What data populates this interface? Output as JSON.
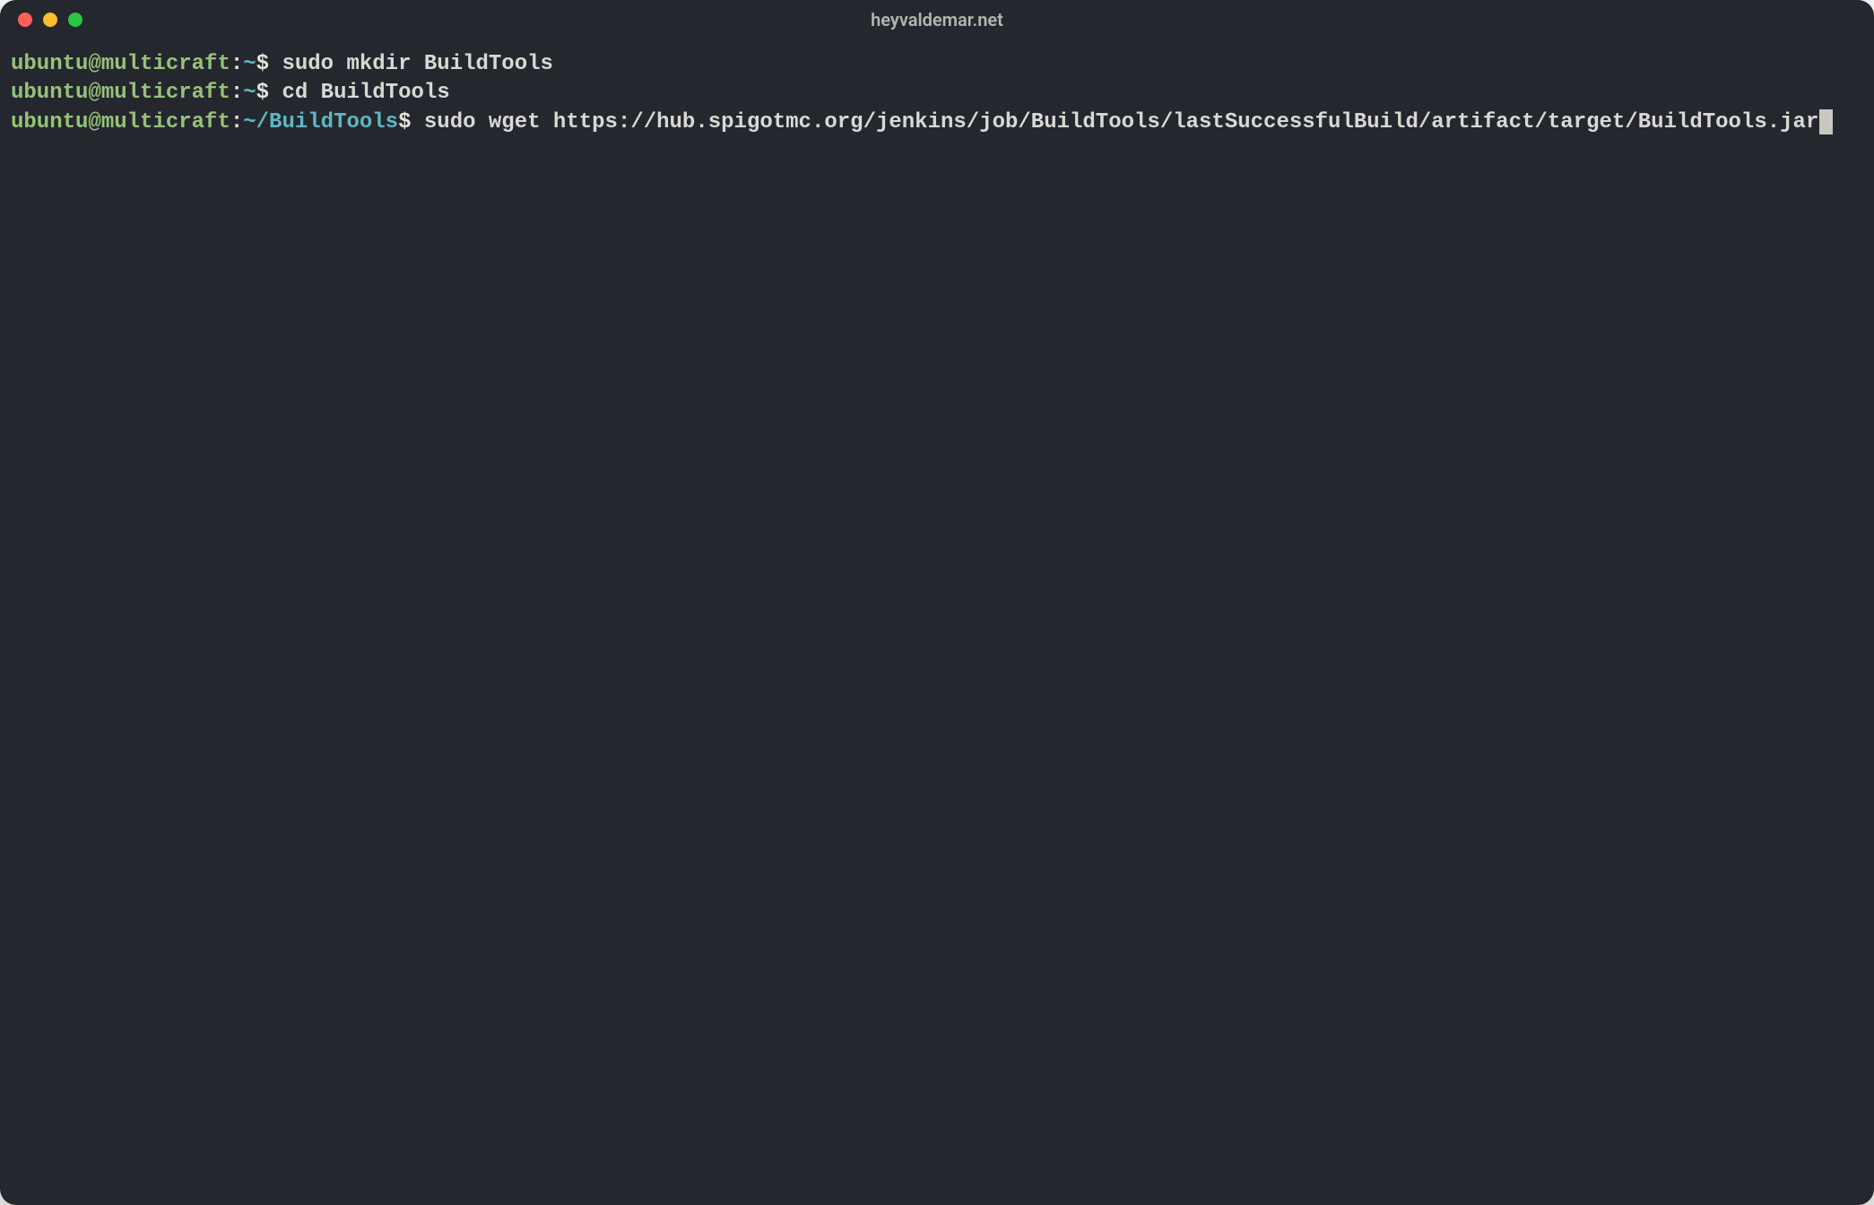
{
  "window": {
    "title": "heyvaldemar.net"
  },
  "colors": {
    "bg": "#24272e",
    "prompt_user": "#97c279",
    "prompt_path": "#60b6c2",
    "text": "#d8d8d4",
    "red_dot": "#ff5f57",
    "yellow_dot": "#febc2e",
    "green_dot": "#28c840"
  },
  "lines": [
    {
      "user": "ubuntu@multicraft",
      "sep": ":",
      "path": "~",
      "dollar": "$",
      "command": " sudo mkdir BuildTools"
    },
    {
      "user": "ubuntu@multicraft",
      "sep": ":",
      "path": "~",
      "dollar": "$",
      "command": " cd BuildTools"
    },
    {
      "user": "ubuntu@multicraft",
      "sep": ":",
      "path": "~/BuildTools",
      "dollar": "$",
      "command": " sudo wget https://hub.spigotmc.org/jenkins/job/BuildTools/lastSuccessfulBuild/artifact/target/BuildTools.jar"
    }
  ]
}
